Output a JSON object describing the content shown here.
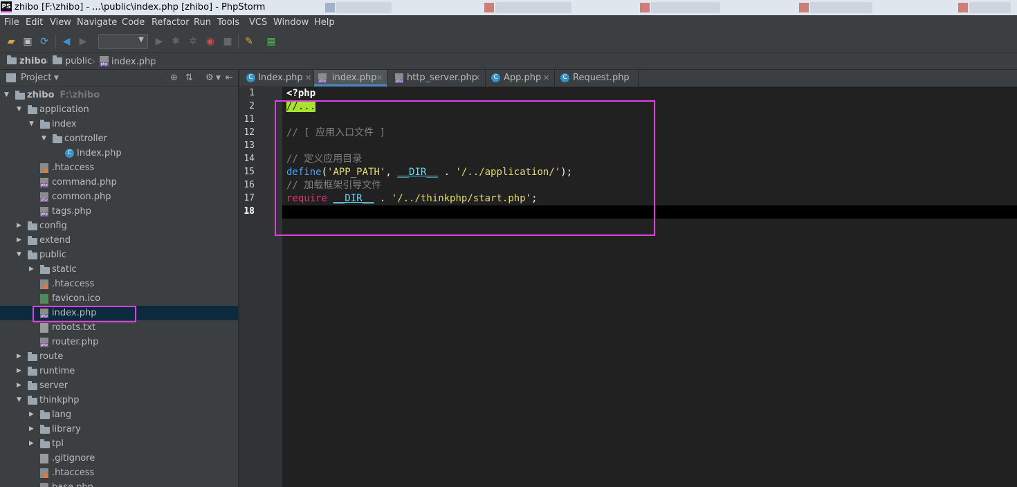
{
  "window": {
    "title": "zhibo [F:\\zhibo] - ...\\public\\index.php [zhibo] - PhpStorm",
    "app_logo": "PS"
  },
  "menu": [
    "File",
    "Edit",
    "View",
    "Navigate",
    "Code",
    "Refactor",
    "Run",
    "Tools",
    "VCS",
    "Window",
    "Help"
  ],
  "breadcrumb": [
    "zhibo",
    "public",
    "index.php"
  ],
  "project_panel": {
    "title": "Project"
  },
  "tree": [
    {
      "name": "zhibo",
      "hint": "F:\\zhibo",
      "type": "folder",
      "depth": 0,
      "expanded": true,
      "bold": true
    },
    {
      "name": "application",
      "type": "folder",
      "depth": 1,
      "expanded": true
    },
    {
      "name": "index",
      "type": "folder",
      "depth": 2,
      "expanded": true
    },
    {
      "name": "controller",
      "type": "folder",
      "depth": 3,
      "expanded": true
    },
    {
      "name": "Index.php",
      "type": "class",
      "depth": 4
    },
    {
      "name": ".htaccess",
      "type": "htaccess",
      "depth": 2
    },
    {
      "name": "command.php",
      "type": "php",
      "depth": 2
    },
    {
      "name": "common.php",
      "type": "php",
      "depth": 2
    },
    {
      "name": "tags.php",
      "type": "php",
      "depth": 2
    },
    {
      "name": "config",
      "type": "folder",
      "depth": 1,
      "expanded": false
    },
    {
      "name": "extend",
      "type": "folder",
      "depth": 1,
      "expanded": false
    },
    {
      "name": "public",
      "type": "folder",
      "depth": 1,
      "expanded": true
    },
    {
      "name": "static",
      "type": "folder",
      "depth": 2,
      "expanded": false
    },
    {
      "name": ".htaccess",
      "type": "htaccess",
      "depth": 2
    },
    {
      "name": "favicon.ico",
      "type": "ico",
      "depth": 2
    },
    {
      "name": "index.php",
      "type": "php",
      "depth": 2,
      "selected": true
    },
    {
      "name": "robots.txt",
      "type": "txt",
      "depth": 2
    },
    {
      "name": "router.php",
      "type": "php",
      "depth": 2
    },
    {
      "name": "route",
      "type": "folder",
      "depth": 1,
      "expanded": false
    },
    {
      "name": "runtime",
      "type": "folder",
      "depth": 1,
      "expanded": false
    },
    {
      "name": "server",
      "type": "folder",
      "depth": 1,
      "expanded": false
    },
    {
      "name": "thinkphp",
      "type": "folder",
      "depth": 1,
      "expanded": true
    },
    {
      "name": "lang",
      "type": "folder",
      "depth": 2,
      "expanded": false
    },
    {
      "name": "library",
      "type": "folder",
      "depth": 2,
      "expanded": false
    },
    {
      "name": "tpl",
      "type": "folder",
      "depth": 2,
      "expanded": false
    },
    {
      "name": ".gitignore",
      "type": "txt",
      "depth": 2
    },
    {
      "name": ".htaccess",
      "type": "htaccess",
      "depth": 2
    },
    {
      "name": "base.php",
      "type": "php",
      "depth": 2
    }
  ],
  "tabs": [
    {
      "label": "Index.php",
      "icon": "class",
      "active": false
    },
    {
      "label": "index.php",
      "icon": "php",
      "active": true
    },
    {
      "label": "http_server.php",
      "icon": "php",
      "active": false
    },
    {
      "label": "App.php",
      "icon": "class",
      "active": false
    },
    {
      "label": "Request.php",
      "icon": "class",
      "active": false
    }
  ],
  "editor": {
    "line_numbers": [
      "1",
      "2",
      "11",
      "12",
      "13",
      "14",
      "15",
      "16",
      "17",
      "18"
    ],
    "lines": {
      "l1": "<?php",
      "l2": "//...",
      "l12": "// [ 应用入口文件 ]",
      "l14": "// 定义应用目录",
      "l15_func": "define",
      "l15_p1": "(",
      "l15_s1": "'APP_PATH'",
      "l15_p2": ", ",
      "l15_c": "__DIR__",
      "l15_p3": " . ",
      "l15_s2": "'/../application/'",
      "l15_p4": ");",
      "l16": "// 加载框架引导文件",
      "l17_kw": "require",
      "l17_sp": " ",
      "l17_c": "__DIR__",
      "l17_p": " . ",
      "l17_s": "'/../thinkphp/start.php'",
      "l17_end": ";"
    },
    "caret_line": "18"
  },
  "colors": {
    "highlight_box": "#e040e0",
    "selection": "#0d293e",
    "active_tab_underline": "#4a88c7"
  }
}
